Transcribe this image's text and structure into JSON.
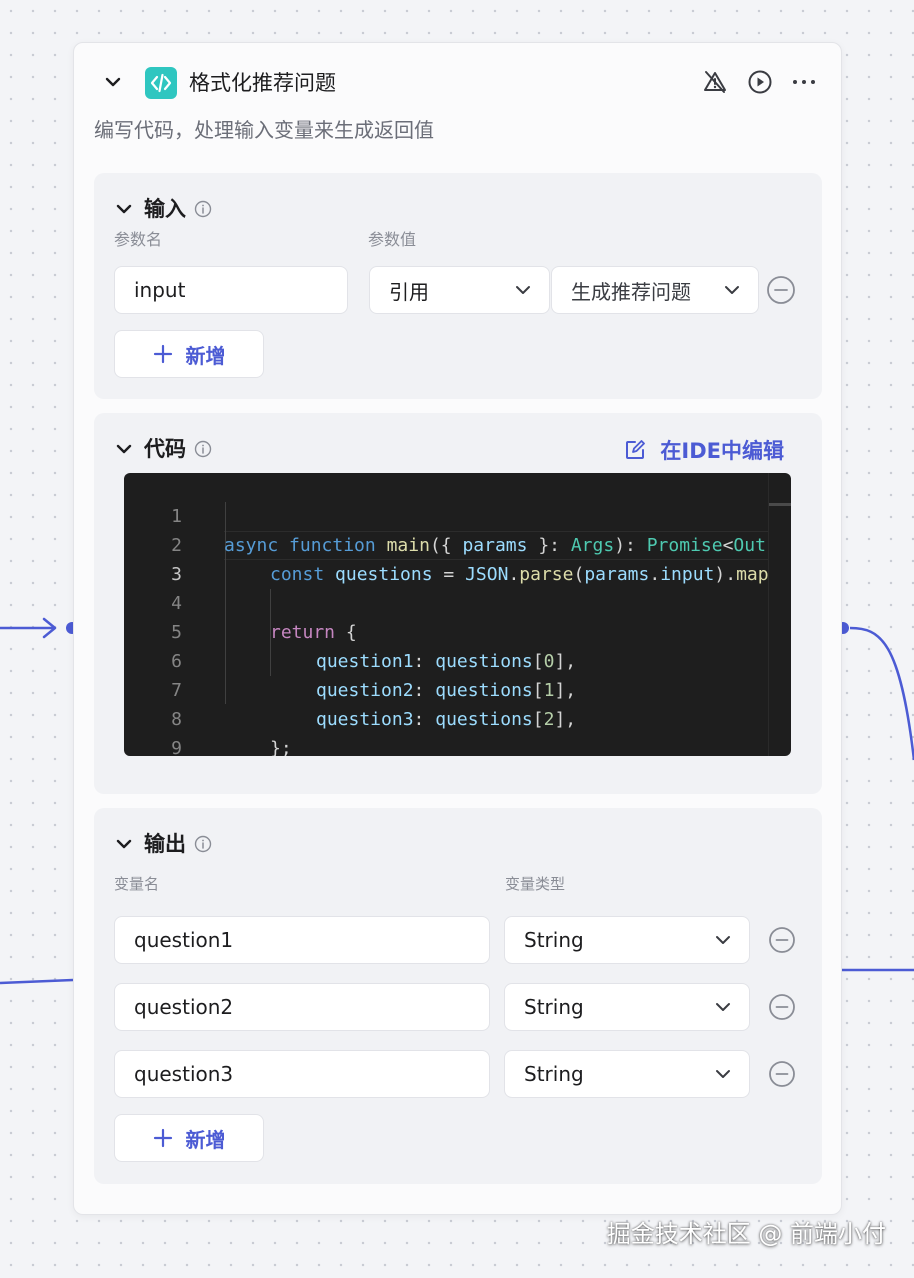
{
  "node": {
    "title": "格式化推荐问题",
    "description": "编写代码，处理输入变量来生成返回值",
    "icon": "code-icon",
    "header_actions": [
      "warning-off-icon",
      "run-icon",
      "more-icon"
    ]
  },
  "input_section": {
    "title": "输入",
    "col_name": "参数名",
    "col_value": "参数值",
    "rows": [
      {
        "name": "input",
        "value_type": "引用",
        "value_ref": "生成推荐问题"
      }
    ],
    "add_label": "新增"
  },
  "code_section": {
    "title": "代码",
    "ide_label": "在IDE中编辑",
    "line_numbers": [
      "1",
      "2",
      "3",
      "4",
      "5",
      "6",
      "7",
      "8",
      "9"
    ],
    "code": {
      "l1_async": "async",
      "l1_function": "function",
      "l1_main": "main",
      "l1_open": "({ ",
      "l1_params": "params",
      "l1_close": " }: ",
      "l1_args": "Args",
      "l1_paren": "): ",
      "l1_promise": "Promise",
      "l1_lt": "<",
      "l1_out": "Out",
      "l2_const": "const",
      "l2_questions": "questions",
      "l2_eq": " = ",
      "l2_json": "JSON",
      "l2_dot": ".",
      "l2_parse": "parse",
      "l2_open": "(",
      "l2_params": "params",
      "l2_dot2": ".",
      "l2_input": "input",
      "l2_close": ").",
      "l2_map": "map",
      "l4_return": "return",
      "l4_brace": " {",
      "l5_key": "question1",
      "l5_colon": ": ",
      "l5_obj": "questions",
      "l5_open": "[",
      "l5_idx": "0",
      "l5_close": "],",
      "l6_key": "question2",
      "l6_colon": ": ",
      "l6_obj": "questions",
      "l6_open": "[",
      "l6_idx": "1",
      "l6_close": "],",
      "l7_key": "question3",
      "l7_colon": ": ",
      "l7_obj": "questions",
      "l7_open": "[",
      "l7_idx": "2",
      "l7_close": "],",
      "l8": "};",
      "l9": "}"
    }
  },
  "output_section": {
    "title": "输出",
    "col_name": "变量名",
    "col_type": "变量类型",
    "rows": [
      {
        "name": "question1",
        "type": "String"
      },
      {
        "name": "question2",
        "type": "String"
      },
      {
        "name": "question3",
        "type": "String"
      }
    ],
    "add_label": "新增"
  },
  "watermark": "掘金技术社区 @ 前端小付",
  "colors": {
    "accent": "#4c5bd4",
    "node_icon_bg": "#2fc6c0",
    "edge": "#4c5bd4"
  }
}
